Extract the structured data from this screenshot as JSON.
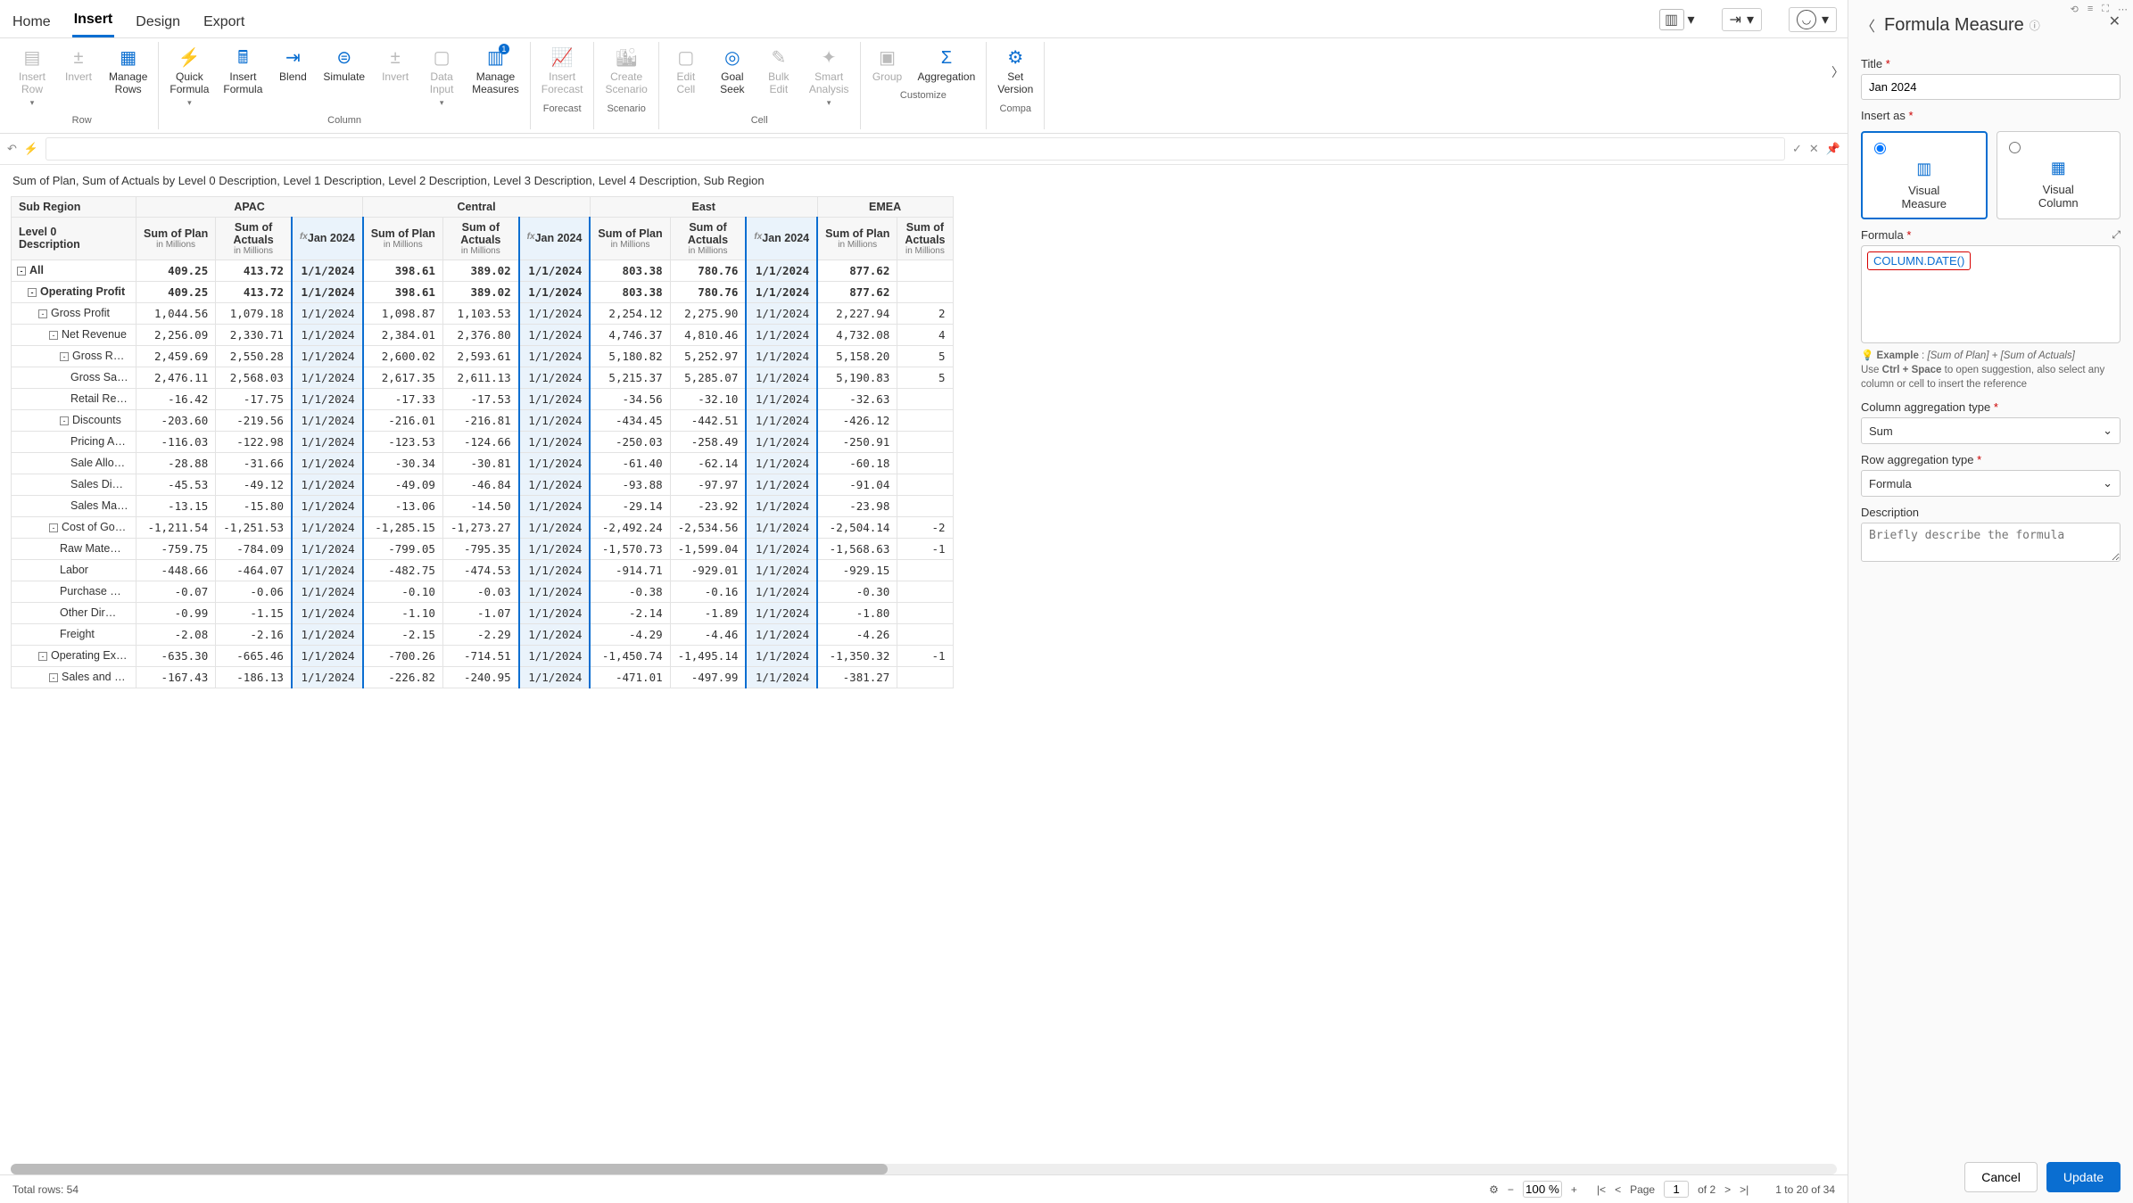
{
  "tabs": {
    "home": "Home",
    "insert": "Insert",
    "design": "Design",
    "export": "Export"
  },
  "ribbon": {
    "row": {
      "label": "Row",
      "insert_row": "Insert\nRow",
      "invert": "Invert",
      "manage_rows": "Manage\nRows"
    },
    "column": {
      "label": "Column",
      "quick_formula": "Quick\nFormula",
      "insert_formula": "Insert\nFormula",
      "blend": "Blend",
      "simulate": "Simulate",
      "invert": "Invert",
      "data_input": "Data\nInput",
      "manage_measures": "Manage\nMeasures"
    },
    "forecast": {
      "label": "Forecast",
      "insert_forecast": "Insert\nForecast"
    },
    "scenario": {
      "label": "Scenario",
      "create_scenario": "Create\nScenario"
    },
    "cell": {
      "label": "Cell",
      "edit_cell": "Edit\nCell",
      "goal_seek": "Goal\nSeek",
      "bulk_edit": "Bulk\nEdit",
      "smart_analysis": "Smart\nAnalysis"
    },
    "customize": {
      "label": "Customize",
      "group": "Group",
      "aggregation": "Aggregation"
    },
    "compare": {
      "label": "Compa",
      "set_version": "Set\nVersion"
    }
  },
  "description": "Sum of Plan, Sum of Actuals by Level 0 Description, Level 1 Description, Level 2 Description, Level 3 Description, Level 4 Description, Sub Region",
  "table": {
    "row_dim_label": "Sub Region",
    "corner": "Level 0\nDescription",
    "regions": [
      "APAC",
      "Central",
      "East",
      "EMEA"
    ],
    "measure_headers": {
      "plan": "Sum of Plan",
      "plan_sub": "in Millions",
      "actuals": "Sum of\nActuals",
      "actuals_sub": "in Millions",
      "jan": "Jan 2024"
    },
    "date_cell": "1/1/2024",
    "rows": [
      {
        "label": "All",
        "indent": 0,
        "exp": "-",
        "bold": true,
        "vals": {
          "APAC": [
            "409.25",
            "413.72"
          ],
          "Central": [
            "398.61",
            "389.02"
          ],
          "East": [
            "803.38",
            "780.76"
          ],
          "EMEA": [
            "877.62",
            ""
          ]
        }
      },
      {
        "label": "Operating Profit",
        "indent": 1,
        "exp": "-",
        "bold": true,
        "vals": {
          "APAC": [
            "409.25",
            "413.72"
          ],
          "Central": [
            "398.61",
            "389.02"
          ],
          "East": [
            "803.38",
            "780.76"
          ],
          "EMEA": [
            "877.62",
            ""
          ]
        }
      },
      {
        "label": "Gross Profit",
        "indent": 2,
        "exp": "-",
        "vals": {
          "APAC": [
            "1,044.56",
            "1,079.18"
          ],
          "Central": [
            "1,098.87",
            "1,103.53"
          ],
          "East": [
            "2,254.12",
            "2,275.90"
          ],
          "EMEA": [
            "2,227.94",
            "2"
          ]
        }
      },
      {
        "label": "Net Revenue",
        "indent": 3,
        "exp": "-",
        "vals": {
          "APAC": [
            "2,256.09",
            "2,330.71"
          ],
          "Central": [
            "2,384.01",
            "2,376.80"
          ],
          "East": [
            "4,746.37",
            "4,810.46"
          ],
          "EMEA": [
            "4,732.08",
            "4"
          ]
        }
      },
      {
        "label": "Gross Rev…",
        "indent": 4,
        "exp": "-",
        "vals": {
          "APAC": [
            "2,459.69",
            "2,550.28"
          ],
          "Central": [
            "2,600.02",
            "2,593.61"
          ],
          "East": [
            "5,180.82",
            "5,252.97"
          ],
          "EMEA": [
            "5,158.20",
            "5"
          ]
        }
      },
      {
        "label": "Gross Sal…",
        "indent": 5,
        "vals": {
          "APAC": [
            "2,476.11",
            "2,568.03"
          ],
          "Central": [
            "2,617.35",
            "2,611.13"
          ],
          "East": [
            "5,215.37",
            "5,285.07"
          ],
          "EMEA": [
            "5,190.83",
            "5"
          ]
        }
      },
      {
        "label": "Retail Re…",
        "indent": 5,
        "vals": {
          "APAC": [
            "-16.42",
            "-17.75"
          ],
          "Central": [
            "-17.33",
            "-17.53"
          ],
          "East": [
            "-34.56",
            "-32.10"
          ],
          "EMEA": [
            "-32.63",
            ""
          ]
        }
      },
      {
        "label": "Discounts",
        "indent": 4,
        "exp": "-",
        "vals": {
          "APAC": [
            "-203.60",
            "-219.56"
          ],
          "Central": [
            "-216.01",
            "-216.81"
          ],
          "East": [
            "-434.45",
            "-442.51"
          ],
          "EMEA": [
            "-426.12",
            ""
          ]
        }
      },
      {
        "label": "Pricing A…",
        "indent": 5,
        "vals": {
          "APAC": [
            "-116.03",
            "-122.98"
          ],
          "Central": [
            "-123.53",
            "-124.66"
          ],
          "East": [
            "-250.03",
            "-258.49"
          ],
          "EMEA": [
            "-250.91",
            ""
          ]
        }
      },
      {
        "label": "Sale Allo…",
        "indent": 5,
        "vals": {
          "APAC": [
            "-28.88",
            "-31.66"
          ],
          "Central": [
            "-30.34",
            "-30.81"
          ],
          "East": [
            "-61.40",
            "-62.14"
          ],
          "EMEA": [
            "-60.18",
            ""
          ]
        }
      },
      {
        "label": "Sales Dis…",
        "indent": 5,
        "vals": {
          "APAC": [
            "-45.53",
            "-49.12"
          ],
          "Central": [
            "-49.09",
            "-46.84"
          ],
          "East": [
            "-93.88",
            "-97.97"
          ],
          "EMEA": [
            "-91.04",
            ""
          ]
        }
      },
      {
        "label": "Sales Ma…",
        "indent": 5,
        "vals": {
          "APAC": [
            "-13.15",
            "-15.80"
          ],
          "Central": [
            "-13.06",
            "-14.50"
          ],
          "East": [
            "-29.14",
            "-23.92"
          ],
          "EMEA": [
            "-23.98",
            ""
          ]
        }
      },
      {
        "label": "Cost of Goo…",
        "indent": 3,
        "exp": "-",
        "vals": {
          "APAC": [
            "-1,211.54",
            "-1,251.53"
          ],
          "Central": [
            "-1,285.15",
            "-1,273.27"
          ],
          "East": [
            "-2,492.24",
            "-2,534.56"
          ],
          "EMEA": [
            "-2,504.14",
            "-2"
          ]
        }
      },
      {
        "label": "Raw Mate…",
        "indent": 4,
        "vals": {
          "APAC": [
            "-759.75",
            "-784.09"
          ],
          "Central": [
            "-799.05",
            "-795.35"
          ],
          "East": [
            "-1,570.73",
            "-1,599.04"
          ],
          "EMEA": [
            "-1,568.63",
            "-1"
          ]
        }
      },
      {
        "label": "Labor",
        "indent": 4,
        "vals": {
          "APAC": [
            "-448.66",
            "-464.07"
          ],
          "Central": [
            "-482.75",
            "-474.53"
          ],
          "East": [
            "-914.71",
            "-929.01"
          ],
          "EMEA": [
            "-929.15",
            ""
          ]
        }
      },
      {
        "label": "Purchase …",
        "indent": 4,
        "vals": {
          "APAC": [
            "-0.07",
            "-0.06"
          ],
          "Central": [
            "-0.10",
            "-0.03"
          ],
          "East": [
            "-0.38",
            "-0.16"
          ],
          "EMEA": [
            "-0.30",
            ""
          ]
        }
      },
      {
        "label": "Other Dir…",
        "indent": 4,
        "vals": {
          "APAC": [
            "-0.99",
            "-1.15"
          ],
          "Central": [
            "-1.10",
            "-1.07"
          ],
          "East": [
            "-2.14",
            "-1.89"
          ],
          "EMEA": [
            "-1.80",
            ""
          ]
        }
      },
      {
        "label": "Freight",
        "indent": 4,
        "vals": {
          "APAC": [
            "-2.08",
            "-2.16"
          ],
          "Central": [
            "-2.15",
            "-2.29"
          ],
          "East": [
            "-4.29",
            "-4.46"
          ],
          "EMEA": [
            "-4.26",
            ""
          ]
        }
      },
      {
        "label": "Operating Ex…",
        "indent": 2,
        "exp": "-",
        "vals": {
          "APAC": [
            "-635.30",
            "-665.46"
          ],
          "Central": [
            "-700.26",
            "-714.51"
          ],
          "East": [
            "-1,450.74",
            "-1,495.14"
          ],
          "EMEA": [
            "-1,350.32",
            "-1"
          ]
        }
      },
      {
        "label": "Sales and M…",
        "indent": 3,
        "exp": "-",
        "vals": {
          "APAC": [
            "-167.43",
            "-186.13"
          ],
          "Central": [
            "-226.82",
            "-240.95"
          ],
          "East": [
            "-471.01",
            "-497.99"
          ],
          "EMEA": [
            "-381.27",
            ""
          ]
        }
      }
    ]
  },
  "footer": {
    "total_rows": "Total rows: 54",
    "zoom": "100 %",
    "page_label": "Page",
    "page_cur": "1",
    "page_of": "of 2",
    "rows_range": "1 to 20 of 34"
  },
  "panel": {
    "title": "Formula Measure",
    "title_field": "Title",
    "title_value": "Jan 2024",
    "insert_as": "Insert as",
    "visual_measure": "Visual\nMeasure",
    "visual_column": "Visual\nColumn",
    "formula_label": "Formula",
    "formula_token": "COLUMN.DATE()",
    "example_label": "Example",
    "example_text": "[Sum of Plan] + [Sum of Actuals]",
    "hint1": "Use ",
    "hint_key": "Ctrl + Space",
    "hint2": " to open suggestion, also select any column or cell to insert the reference",
    "col_agg": "Column aggregation type",
    "col_agg_val": "Sum",
    "row_agg": "Row aggregation type",
    "row_agg_val": "Formula",
    "desc_label": "Description",
    "desc_ph": "Briefly describe the formula",
    "cancel": "Cancel",
    "update": "Update"
  }
}
